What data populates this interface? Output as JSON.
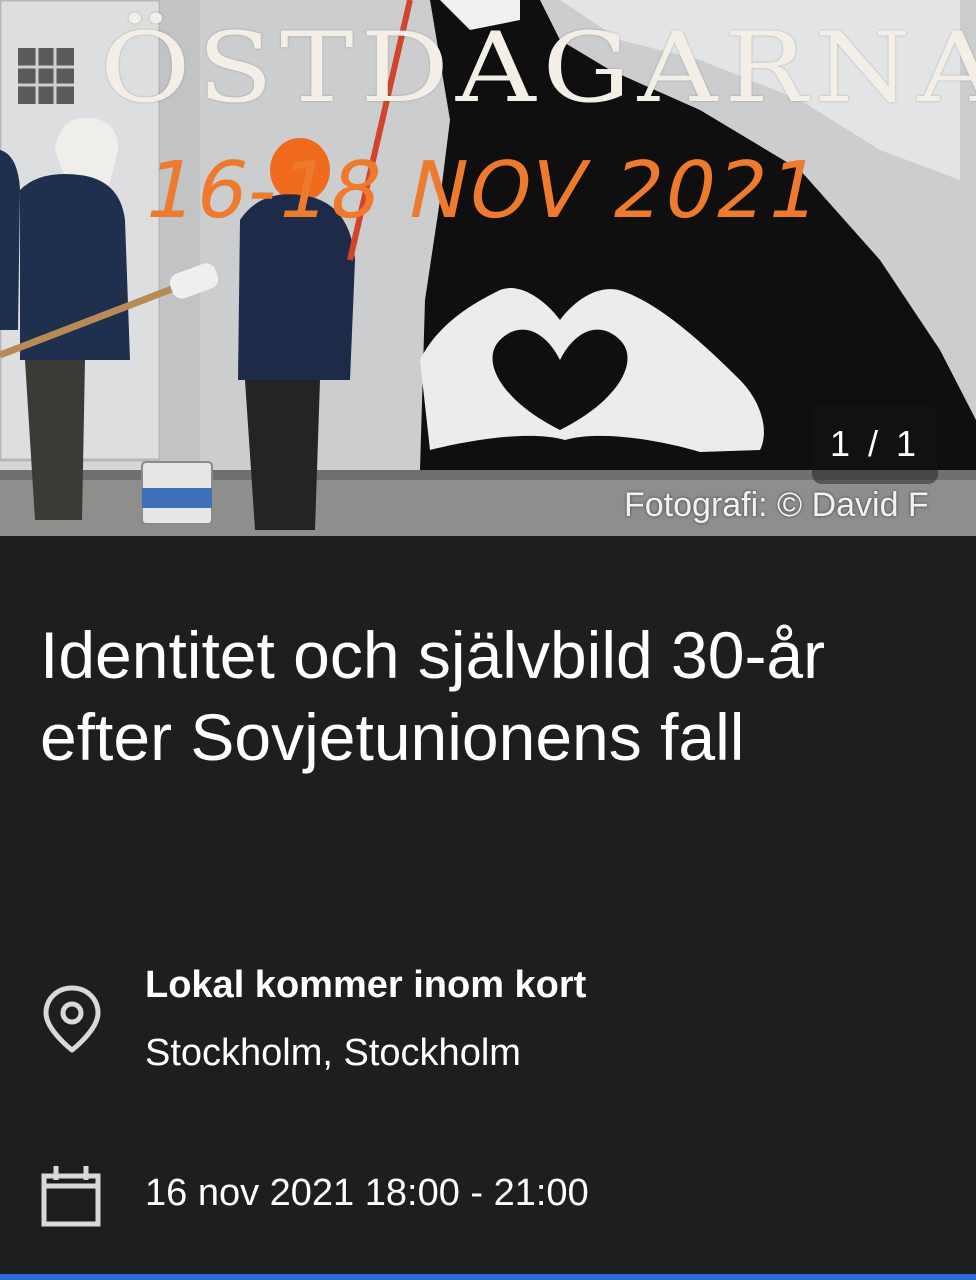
{
  "hero": {
    "title": "ÖSTDAGARNA",
    "date": "16-18 NOV 2021",
    "counter": "1 / 1",
    "credit": "Fotografi: © David F"
  },
  "event": {
    "title": "Identitet och självbild 30-år efter Sovjetunionens fall",
    "venue": "Lokal kommer inom kort",
    "city": "Stockholm, Stockholm",
    "datetime": "16 nov 2021 18:00 - 21:00"
  },
  "icons": {
    "location": "location-pin-icon",
    "date": "calendar-icon"
  },
  "colors": {
    "background": "#1d1e20",
    "text": "#ffffff",
    "date_accent": "#ee7a2e",
    "bottom_bar": "#2b6fd6"
  }
}
